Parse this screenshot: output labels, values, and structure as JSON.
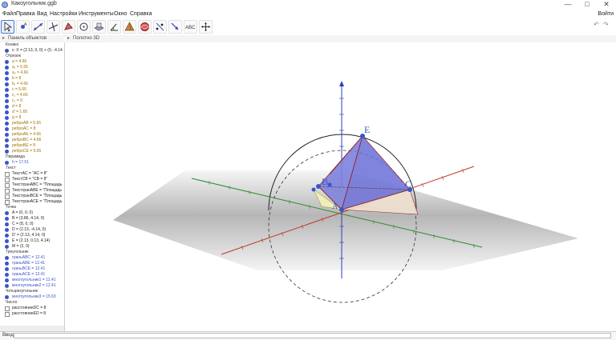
{
  "window": {
    "title": "Какоугольник.ggb",
    "minimize": "—",
    "maximize": "□",
    "close": "✕"
  },
  "menu": {
    "items": [
      "Файл",
      "Правка",
      "Вид",
      "Настройки",
      "Инструменты",
      "Окно",
      "Справка"
    ],
    "signin": "Войти"
  },
  "toolbar": {
    "tools": [
      "move",
      "point",
      "line",
      "perpendicular",
      "polygon",
      "circle",
      "intersect",
      "angle",
      "reflect",
      "text",
      "zoom",
      "pyramid",
      "sphere",
      "view"
    ],
    "active": 0
  },
  "panels": {
    "algebra_title": "Панель объектов",
    "graphics_title": "Полотно 3D"
  },
  "algebra": {
    "rows": [
      {
        "kind": "head",
        "text": "Конико"
      },
      {
        "kind": "obj",
        "text": "c: X = (2.13, 0, 0) + (0, -4.14 ·",
        "color": "#222"
      },
      {
        "kind": "head",
        "text": "Отрезок"
      },
      {
        "kind": "obj",
        "text": "a = 4.66",
        "color": "#a07000"
      },
      {
        "kind": "obj",
        "text": "a₁ = 5.65",
        "color": "#a07000"
      },
      {
        "kind": "obj",
        "text": "a₂ = 4.66",
        "color": "#a07000"
      },
      {
        "kind": "obj",
        "text": "b = 8",
        "color": "#a07000"
      },
      {
        "kind": "obj",
        "text": "b₁ = 4.66",
        "color": "#a07000"
      },
      {
        "kind": "obj",
        "text": "c = 5.65",
        "color": "#a07000"
      },
      {
        "kind": "obj",
        "text": "c₁ = 4.66",
        "color": "#a07000"
      },
      {
        "kind": "obj",
        "text": "c₂ = 0",
        "color": "#a07000"
      },
      {
        "kind": "obj",
        "text": "d = 8",
        "color": "#a07000"
      },
      {
        "kind": "obj",
        "text": "d' = 1.65",
        "color": "#a07000"
      },
      {
        "kind": "obj",
        "text": "g = 8",
        "color": "#a07000"
      },
      {
        "kind": "obj",
        "text": "реброAB = 5.65",
        "color": "#a07000"
      },
      {
        "kind": "obj",
        "text": "реброAC = 8",
        "color": "#a07000"
      },
      {
        "kind": "obj",
        "text": "реброAE = 4.66",
        "color": "#a07000"
      },
      {
        "kind": "obj",
        "text": "реброBC = 4.66",
        "color": "#a07000"
      },
      {
        "kind": "obj",
        "text": "реброBE = 8",
        "color": "#a07000"
      },
      {
        "kind": "obj",
        "text": "реброCE = 5.65",
        "color": "#a07000"
      },
      {
        "kind": "head",
        "text": "Пирамида"
      },
      {
        "kind": "obj",
        "text": "h = 17.51",
        "color": "#3b54c8"
      },
      {
        "kind": "head",
        "text": "Текст"
      },
      {
        "kind": "box",
        "text": "ТекстAC = \"AC = 8\"",
        "color": "#222"
      },
      {
        "kind": "box",
        "text": "ТекстCB = \"CB = 8\"",
        "color": "#222"
      },
      {
        "kind": "box",
        "text": "ТекстгранABC = \"Площадь",
        "color": "#222"
      },
      {
        "kind": "box",
        "text": "ТекстгранABE = \"Площадь",
        "color": "#222"
      },
      {
        "kind": "box",
        "text": "ТекстгранBCE = \"Площадь",
        "color": "#222"
      },
      {
        "kind": "box",
        "text": "ТекстгранACE = \"Площадь",
        "color": "#222"
      },
      {
        "kind": "head",
        "text": "Точка"
      },
      {
        "kind": "obj",
        "text": "A = (0, 0, 0)",
        "color": "#222"
      },
      {
        "kind": "obj",
        "text": "B = (3.86, 4.14, 0)",
        "color": "#222"
      },
      {
        "kind": "obj",
        "text": "C = (8, 0, 0)",
        "color": "#222"
      },
      {
        "kind": "obj",
        "text": "D = (2.13, -4.14, 0)",
        "color": "#222"
      },
      {
        "kind": "obj",
        "text": "D' = (2.13, 4.14, 0)",
        "color": "#222"
      },
      {
        "kind": "obj",
        "text": "E = (2.13, 0.13, 4.14)",
        "color": "#222"
      },
      {
        "kind": "obj",
        "text": "M = (2, 0)",
        "color": "#222"
      },
      {
        "kind": "head",
        "text": "Треугольник"
      },
      {
        "kind": "obj",
        "text": "граньABC = 12.41",
        "color": "#3b54c8"
      },
      {
        "kind": "obj",
        "text": "граньABE = 12.41",
        "color": "#3b54c8"
      },
      {
        "kind": "obj",
        "text": "граньBCE = 12.41",
        "color": "#3b54c8"
      },
      {
        "kind": "obj",
        "text": "граньACE = 12.41",
        "color": "#3b54c8"
      },
      {
        "kind": "obj",
        "text": "многоугольник1 = 12.41",
        "color": "#3b54c8"
      },
      {
        "kind": "obj",
        "text": "многоугольник2 = 12.41",
        "color": "#3b54c8"
      },
      {
        "kind": "head",
        "text": "Четырехугольник"
      },
      {
        "kind": "obj",
        "text": "многоугольник3 = 15.63",
        "color": "#3b54c8"
      },
      {
        "kind": "head",
        "text": "Число"
      },
      {
        "kind": "box",
        "text": "расстояниеDC = 8",
        "color": "#222"
      },
      {
        "kind": "box",
        "text": "расстояниеED = 8",
        "color": "#222"
      }
    ]
  },
  "graphics": {
    "labels": {
      "E": "E",
      "B": "B",
      "C": "C",
      "A": "A"
    },
    "colors": {
      "face": "#6a6fd8",
      "edge": "#8b1a1a",
      "axis_x": "#c0392b",
      "axis_y": "#2e8b2e",
      "axis_z": "#2d3fbf"
    }
  },
  "inputbar": {
    "label": "Ввод:"
  }
}
